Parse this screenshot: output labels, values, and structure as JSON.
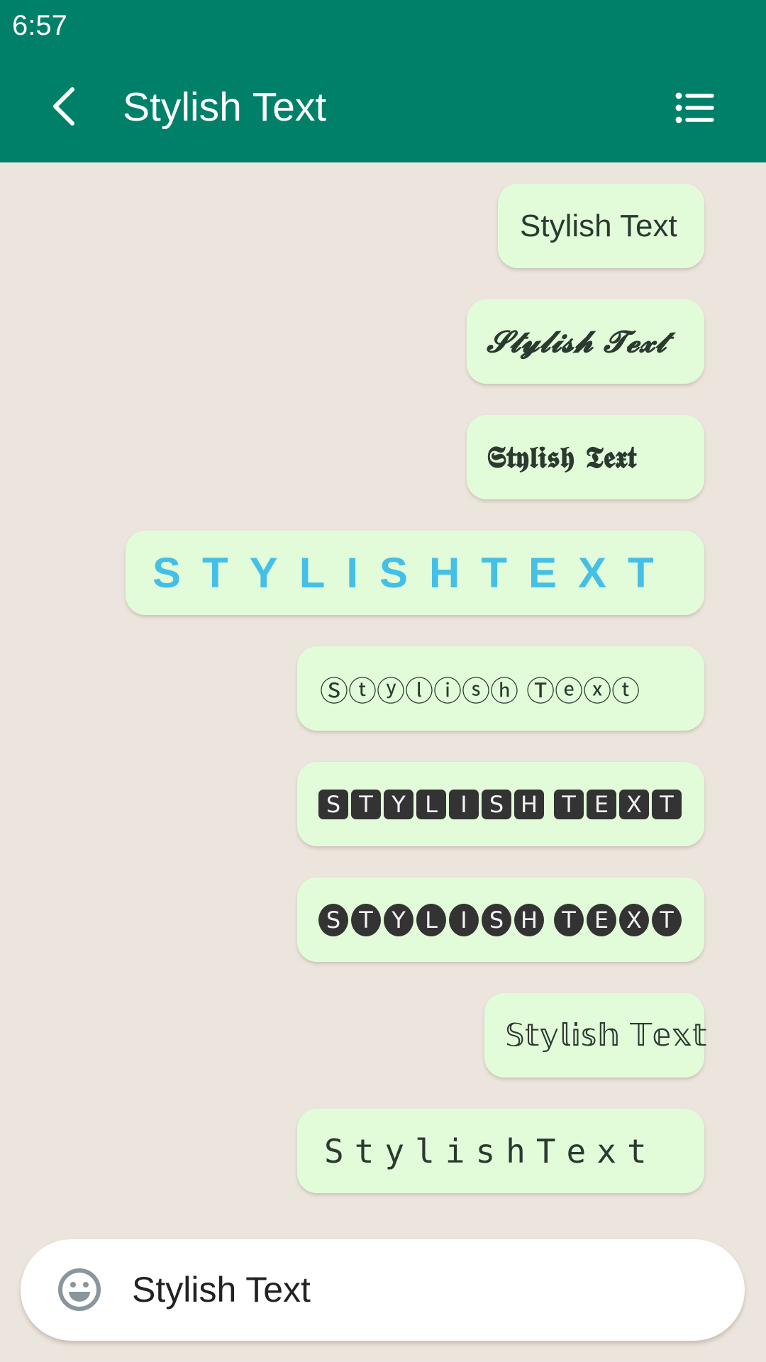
{
  "status_bar": {
    "time": "6:57"
  },
  "app_bar": {
    "title": "Stylish Text",
    "back_icon": "chevron-left-icon",
    "menu_icon": "list-icon",
    "color": "#008069"
  },
  "messages": [
    {
      "style": "plain",
      "text": "Stylish Text"
    },
    {
      "style": "script",
      "text": "𝓢𝓽𝔂𝓵𝓲𝓼𝓱 𝓣𝓮𝔁𝓽"
    },
    {
      "style": "fraktur",
      "text": "𝕾𝖙𝖞𝖑𝖎𝖘𝖍 𝕿𝖊𝖝𝖙"
    },
    {
      "style": "spaced-caps",
      "text": "STYLISHTEXT",
      "color": "#45bfe6"
    },
    {
      "style": "circled",
      "text": "Ⓢⓣⓨⓛⓘⓢⓗ Ⓣⓔⓧⓣ"
    },
    {
      "style": "squared-negative",
      "letters": [
        "S",
        "T",
        "Y",
        "L",
        "I",
        "S",
        "H",
        " ",
        "T",
        "E",
        "X",
        "T"
      ]
    },
    {
      "style": "circled-negative",
      "letters": [
        "S",
        "T",
        "Y",
        "L",
        "I",
        "S",
        "H",
        " ",
        "T",
        "E",
        "X",
        "T"
      ]
    },
    {
      "style": "double-struck",
      "text": "𝕊𝕥𝕪𝕝𝕚𝕤𝕙 𝕋𝕖𝕩𝕥"
    },
    {
      "style": "monospace-spaced",
      "text": "StylishText"
    }
  ],
  "input": {
    "value": "Stylish Text",
    "emoji_icon": "smiley-icon"
  },
  "colors": {
    "background": "#ece5dd",
    "bubble": "#e2fcd9",
    "text": "#2b3a30"
  }
}
